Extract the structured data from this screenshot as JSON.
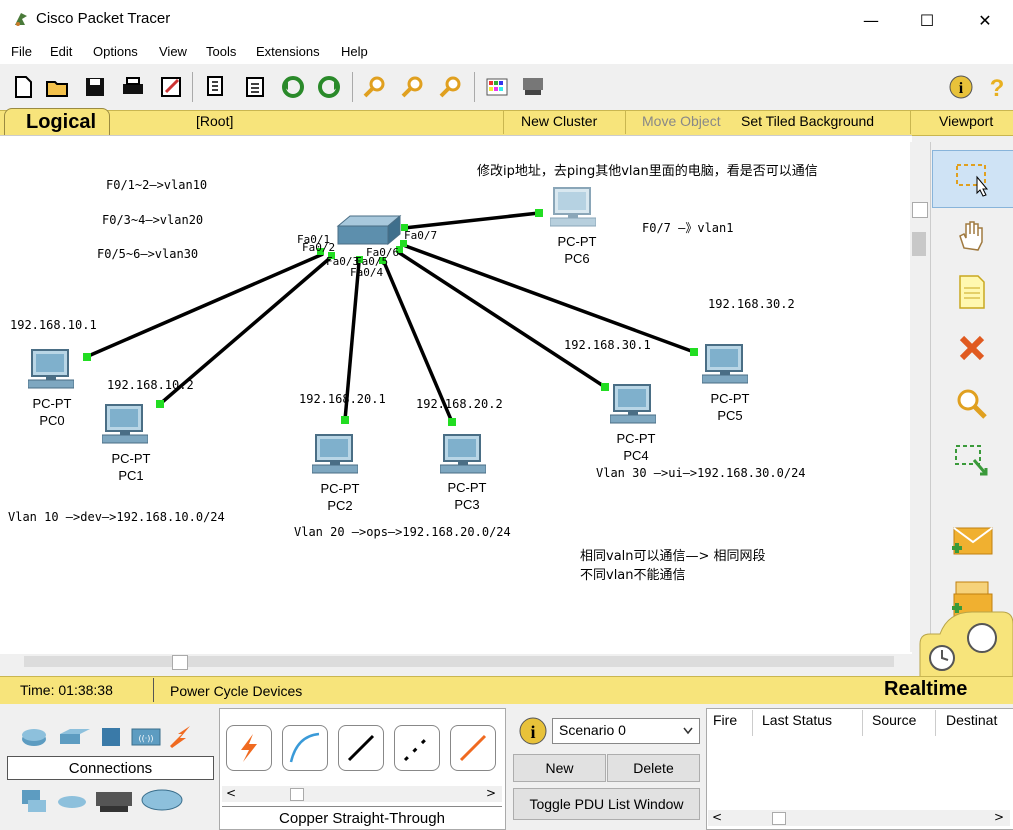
{
  "window": {
    "title": "Cisco Packet Tracer",
    "min": "—",
    "max": "☐",
    "close": "✕"
  },
  "menu": [
    "File",
    "Edit",
    "Options",
    "View",
    "Tools",
    "Extensions",
    "Help"
  ],
  "toolbar": {
    "icons": [
      "new-icon",
      "open-icon",
      "save-icon",
      "print-icon",
      "activity-wizard-icon",
      "copy-icon",
      "paste-icon",
      "undo-icon",
      "redo-icon",
      "zoom-in-icon",
      "zoom-reset-icon",
      "zoom-out-icon",
      "palette-icon",
      "custom-device-icon"
    ],
    "help_icons": [
      "info-icon",
      "help-icon"
    ]
  },
  "logical_bar": {
    "tab": "Logical",
    "root": "[Root]",
    "new_cluster": "New Cluster",
    "move_object": "Move Object",
    "set_tiled_background": "Set Tiled Background",
    "viewport": "Viewport"
  },
  "canvas": {
    "notes": {
      "vlan10_ports": "F0/1~2—>vlan10",
      "vlan20_ports": "F0/3~4—>vlan20",
      "vlan30_ports": "F0/5~6—>vlan30",
      "vlan1_port": "F0/7 —》vlan1",
      "ping_task": "修改ip地址，去ping其他vlan里面的电脑，看是否可以通信",
      "vlan10_desc": "Vlan 10 —>dev—>192.168.10.0/24",
      "vlan20_desc": "Vlan 20 —>ops—>192.168.20.0/24",
      "vlan30_desc": "Vlan 30 —>ui—>192.168.30.0/24",
      "same_vlan": "相同valn可以通信—> 相同网段",
      "diff_vlan": "不同vlan不能通信"
    },
    "ips": {
      "pc0": "192.168.10.1",
      "pc1": "192.168.10.2",
      "pc2": "192.168.20.1",
      "pc3": "192.168.20.2",
      "pc4": "192.168.30.1",
      "pc5": "192.168.30.2"
    },
    "pcs": [
      {
        "type": "PC-PT",
        "name": "PC0"
      },
      {
        "type": "PC-PT",
        "name": "PC1"
      },
      {
        "type": "PC-PT",
        "name": "PC2"
      },
      {
        "type": "PC-PT",
        "name": "PC3"
      },
      {
        "type": "PC-PT",
        "name": "PC4"
      },
      {
        "type": "PC-PT",
        "name": "PC5"
      },
      {
        "type": "PC-PT",
        "name": "PC6"
      }
    ],
    "ports": [
      "Fa0/1",
      "Fa0/2",
      "Fa0/3",
      "Fa0/4",
      "Fa0/5",
      "Fa0/6",
      "Fa0/7"
    ]
  },
  "status": {
    "time": "Time: 01:38:38",
    "power_cycle": "Power Cycle Devices",
    "mode": "Realtime"
  },
  "bottom": {
    "category_label": "Connections",
    "connection_type": "Copper Straight-Through",
    "scenario": "Scenario 0",
    "new_btn": "New",
    "delete_btn": "Delete",
    "toggle_pdu": "Toggle PDU List Window",
    "pdu_columns": [
      "Fire",
      "Last Status",
      "Source",
      "Destinat"
    ]
  },
  "colors": {
    "yellow_bar": "#f7e47b",
    "link_green": "#22cc22",
    "pc_blue": "#5d9cc1"
  }
}
